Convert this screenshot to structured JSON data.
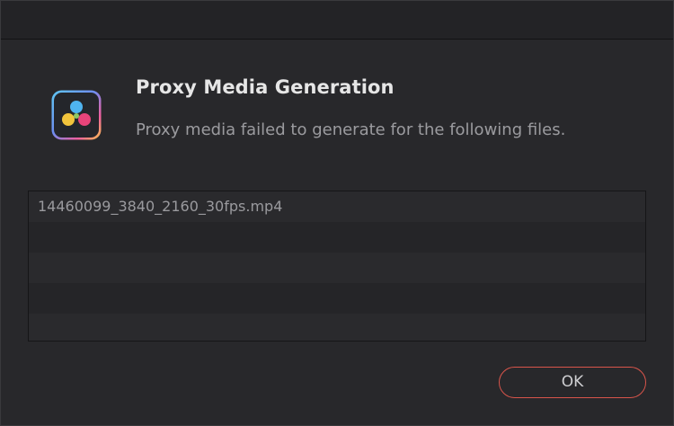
{
  "dialog": {
    "heading": "Proxy Media Generation",
    "message": "Proxy media failed to generate for the following files."
  },
  "file_list": {
    "rows": [
      "14460099_3840_2160_30fps.mp4",
      "",
      "",
      "",
      ""
    ]
  },
  "buttons": {
    "ok_label": "OK"
  },
  "icon": {
    "name": "davinci-resolve-app-icon"
  },
  "colors": {
    "accent_border": "#d9554b",
    "background": "#28282b"
  }
}
